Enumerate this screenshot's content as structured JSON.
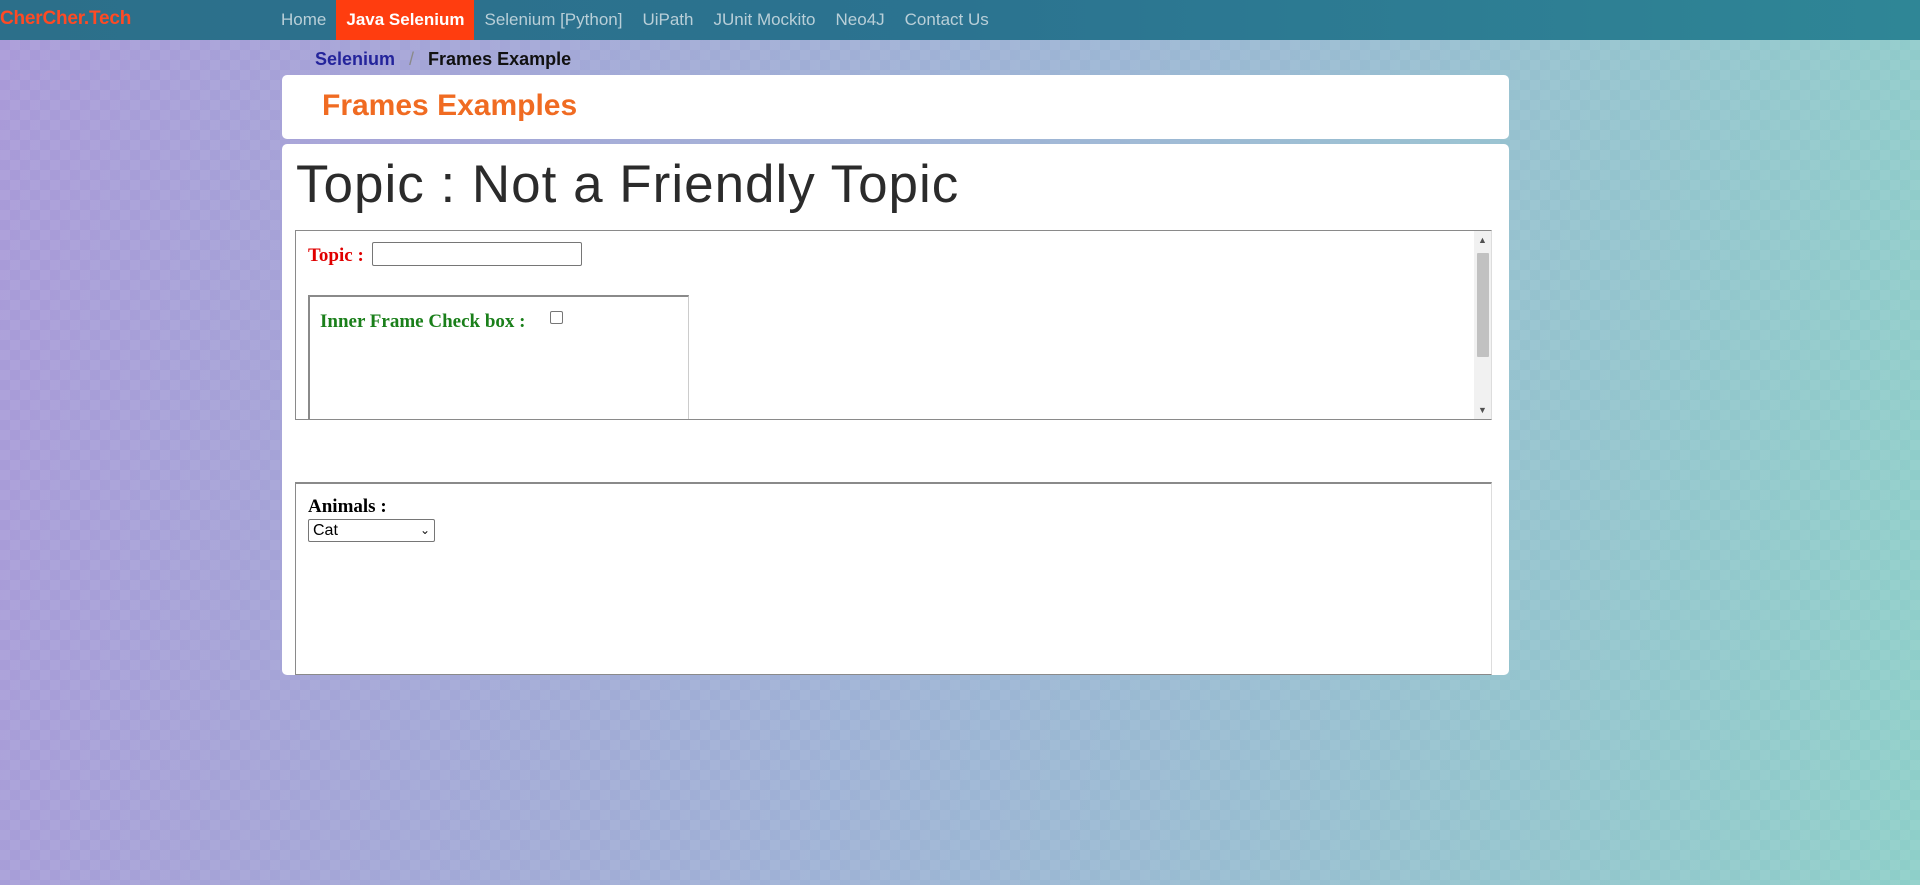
{
  "brand": "CherCher.Tech",
  "nav": {
    "items": [
      {
        "label": "Home"
      },
      {
        "label": "Java Selenium",
        "active": true
      },
      {
        "label": "Selenium [Python]"
      },
      {
        "label": "UiPath"
      },
      {
        "label": "JUnit Mockito"
      },
      {
        "label": "Neo4J"
      },
      {
        "label": "Contact Us"
      }
    ]
  },
  "breadcrumb": {
    "link": "Selenium",
    "separator": "/",
    "current": "Frames Example"
  },
  "page_title": "Frames Examples",
  "topic_heading": "Topic : Not a Friendly Topic",
  "frame1": {
    "topic_label": "Topic :",
    "topic_value": "",
    "inner_frame": {
      "checkbox_label": "Inner Frame Check box :",
      "checked": false
    }
  },
  "frame2": {
    "animals_label": "Animals :",
    "selected": "Cat"
  },
  "colors": {
    "brand": "#ff4a24",
    "nav_active": "#ff3d0f",
    "page_title": "#f06b22",
    "topic_label": "#e00000",
    "inner_label": "#1a7f1a",
    "breadcrumb_link": "#24249b"
  }
}
